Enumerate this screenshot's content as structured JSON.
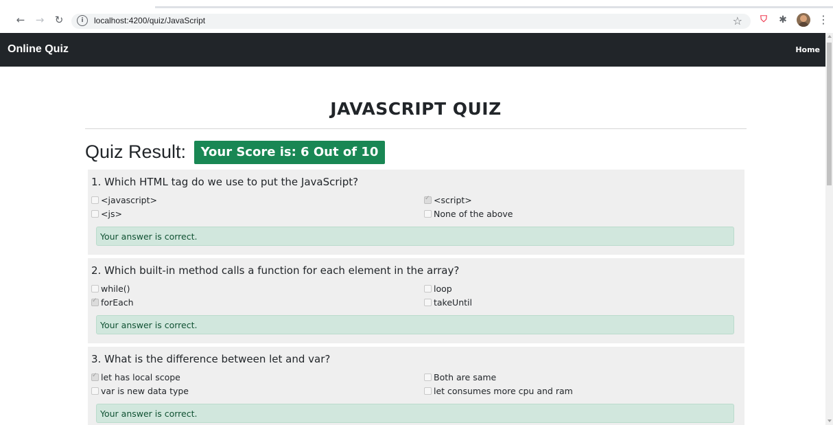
{
  "browser": {
    "url": "localhost:4200/quiz/JavaScript"
  },
  "navbar": {
    "brand": "Online Quiz",
    "home_link": "Home"
  },
  "page": {
    "title": "JAVASCRIPT QUIZ",
    "result_label": "Quiz Result:",
    "score_text": "Your Score is: 6 Out of 10",
    "score_color": "#198754"
  },
  "questions": [
    {
      "title": "1. Which HTML tag do we use to put the JavaScript?",
      "options": [
        {
          "label": "<javascript>",
          "checked": false
        },
        {
          "label": "<script>",
          "checked": true
        },
        {
          "label": "<js>",
          "checked": false
        },
        {
          "label": "None of the above",
          "checked": false
        }
      ],
      "feedback": "Your answer is correct."
    },
    {
      "title": "2. Which built-in method calls a function for each element in the array?",
      "options": [
        {
          "label": "while()",
          "checked": false
        },
        {
          "label": "loop",
          "checked": false
        },
        {
          "label": "forEach",
          "checked": true
        },
        {
          "label": "takeUntil",
          "checked": false
        }
      ],
      "feedback": "Your answer is correct."
    },
    {
      "title": "3. What is the difference between let and var?",
      "options": [
        {
          "label": "let has local scope",
          "checked": true
        },
        {
          "label": "Both are same",
          "checked": false
        },
        {
          "label": "var is new data type",
          "checked": false
        },
        {
          "label": "let consumes more cpu and ram",
          "checked": false
        }
      ],
      "feedback": "Your answer is correct."
    }
  ],
  "colors": {
    "navbar_bg": "#212529",
    "feedback_bg": "#d1e7dd",
    "question_bg": "#efefef"
  }
}
